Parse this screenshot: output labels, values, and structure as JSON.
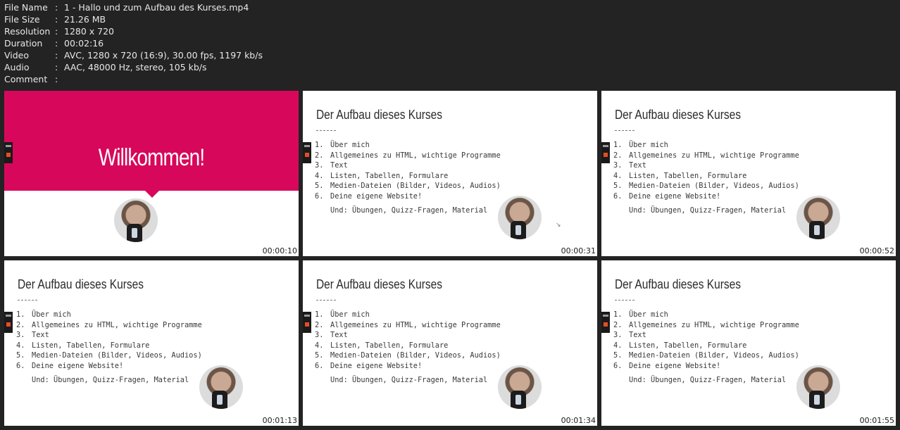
{
  "meta": [
    {
      "key": "File Name",
      "sep": ":",
      "value": "1 - Hallo und zum Aufbau des Kurses.mp4"
    },
    {
      "key": "File Size",
      "sep": ":",
      "value": "21.26 MB"
    },
    {
      "key": "Resolution",
      "sep": ":",
      "value": "1280 x 720"
    },
    {
      "key": "Duration",
      "sep": ":",
      "value": "00:02:16"
    },
    {
      "key": "Video",
      "sep": ":",
      "value": "AVC, 1280 x 720 (16:9), 30.00 fps, 1197 kb/s"
    },
    {
      "key": "Audio",
      "sep": ":",
      "value": "AAC, 48000 Hz, stereo, 105 kb/s"
    },
    {
      "key": "Comment",
      "sep": ":",
      "value": ""
    }
  ],
  "welcome": {
    "title": "Willkommen!"
  },
  "slide": {
    "title": "Der Aufbau dieses Kurses",
    "items": [
      {
        "num": "1.",
        "text": "Über mich"
      },
      {
        "num": "2.",
        "text": "Allgemeines zu HTML, wichtige Programme"
      },
      {
        "num": "3.",
        "text": "Text"
      },
      {
        "num": "4.",
        "text": "Listen, Tabellen, Formulare"
      },
      {
        "num": "5.",
        "text": "Medien-Dateien (Bilder, Videos, Audios)"
      },
      {
        "num": "6.",
        "text": "Deine eigene Website!"
      }
    ],
    "extras": "Und: Übungen, Quizz-Fragen, Material"
  },
  "thumbnails": [
    {
      "timestamp": "00:00:10"
    },
    {
      "timestamp": "00:00:31"
    },
    {
      "timestamp": "00:00:52"
    },
    {
      "timestamp": "00:01:13"
    },
    {
      "timestamp": "00:01:34"
    },
    {
      "timestamp": "00:01:55"
    }
  ]
}
